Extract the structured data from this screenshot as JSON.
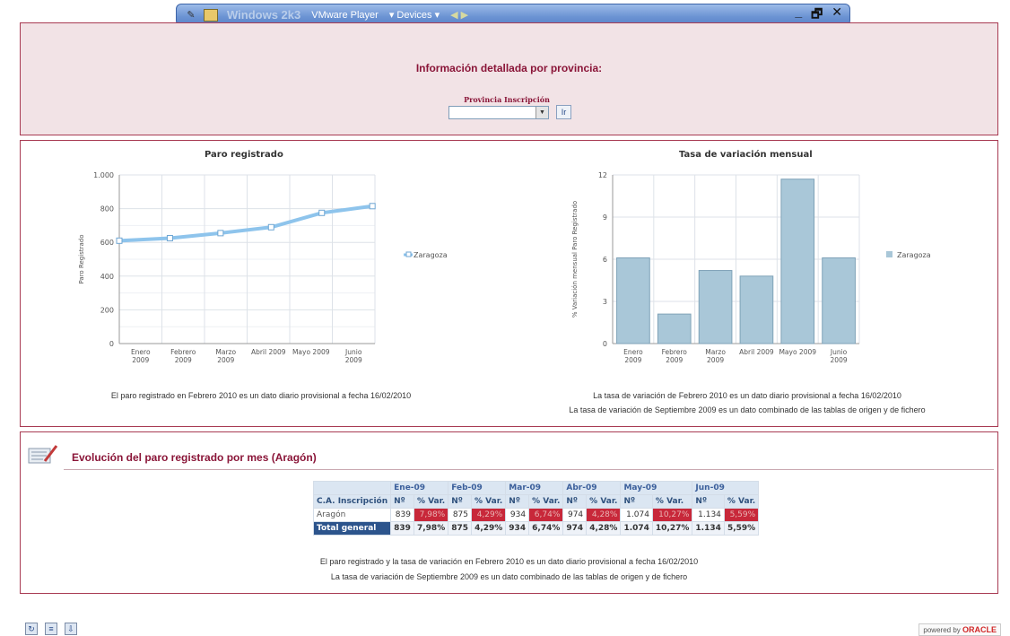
{
  "vm_toolbar": {
    "title": "Windows 2k3",
    "items": [
      "VMware Player",
      "▾ Devices ▾"
    ],
    "controls": [
      "_",
      "🗗",
      "✕"
    ]
  },
  "province": {
    "title": "Información detallada por provincia:",
    "label": "Provincia Inscripción",
    "selected": "",
    "go_label": "Ir"
  },
  "charts": {
    "left_title": "Paro registrado",
    "right_title": "Tasa de variación mensual",
    "left_note": "El paro registrado en Febrero 2010 es un dato diario provisional a fecha 16/02/2010",
    "right_note_1": "La tasa de variación de Febrero 2010 es un dato diario provisional a fecha 16/02/2010",
    "right_note_2": "La tasa de variación de Septiembre 2009 es un dato combinado de las tablas de origen y de fichero"
  },
  "chart_data": [
    {
      "type": "line",
      "title": "Paro registrado",
      "ylabel": "Paro Registrado",
      "categories": [
        "Enero 2009",
        "Febrero 2009",
        "Marzo 2009",
        "Abril 2009",
        "Mayo 2009",
        "Junio 2009"
      ],
      "series": [
        {
          "name": "Zaragoza",
          "values": [
            610,
            625,
            655,
            690,
            775,
            815
          ]
        }
      ],
      "ylim": [
        0,
        1000
      ],
      "yticks": [
        "0",
        "200",
        "400",
        "600",
        "800",
        "1.000"
      ],
      "grid": true,
      "legend": "right",
      "color": "#8ec4ec"
    },
    {
      "type": "bar",
      "title": "Tasa de variación mensual",
      "ylabel": "% Variación mensual Paro Registrado",
      "categories": [
        "Enero 2009",
        "Febrero 2009",
        "Marzo 2009",
        "Abril 2009",
        "Mayo 2009",
        "Junio 2009"
      ],
      "series": [
        {
          "name": "Zaragoza",
          "values": [
            6.1,
            2.1,
            5.2,
            4.8,
            11.7,
            6.1
          ]
        }
      ],
      "ylim": [
        0,
        12
      ],
      "yticks": [
        "0",
        "3",
        "6",
        "9",
        "12"
      ],
      "grid": true,
      "legend": "right",
      "color": "#a9c7d8"
    }
  ],
  "section": {
    "title": "Evolución del paro registrado por mes (Aragón)"
  },
  "table": {
    "corner": "",
    "months": [
      "Ene-09",
      "Feb-09",
      "Mar-09",
      "Abr-09",
      "May-09",
      "Jun-09"
    ],
    "row_header": "C.A. Inscripción",
    "sub_headers": [
      "Nº",
      "% Var."
    ],
    "rows": [
      {
        "label": "Aragón",
        "cells": [
          "839",
          "7,98%",
          "875",
          "4,29%",
          "934",
          "6,74%",
          "974",
          "4,28%",
          "1.074",
          "10,27%",
          "1.134",
          "5,59%"
        ]
      }
    ],
    "total": {
      "label": "Total general",
      "cells": [
        "839",
        "7,98%",
        "875",
        "4,29%",
        "934",
        "6,74%",
        "974",
        "4,28%",
        "1.074",
        "10,27%",
        "1.134",
        "5,59%"
      ]
    },
    "note_1": "El paro registrado y la tasa de variación en Febrero 2010 es un dato diario provisional a fecha 16/02/2010",
    "note_2": "La tasa de variación de Septiembre 2009 es un dato combinado de las tablas de origen y de fichero"
  },
  "footer": {
    "icons": [
      "refresh-icon",
      "print-icon",
      "export-icon"
    ],
    "powered_by": "powered by",
    "brand": "ORACLE"
  }
}
